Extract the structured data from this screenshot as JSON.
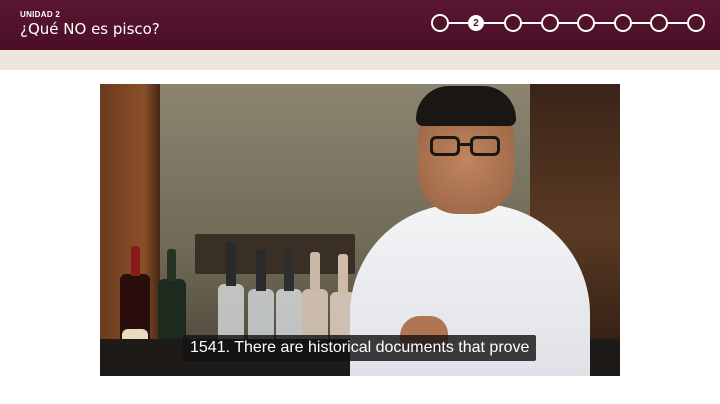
{
  "header": {
    "unit_label": "UNIDAD 2",
    "lesson_title": "¿Qué NO es pisco?"
  },
  "stepper": {
    "steps": [
      {
        "label": "",
        "active": false
      },
      {
        "label": "2",
        "active": true
      },
      {
        "label": "",
        "active": false
      },
      {
        "label": "",
        "active": false
      },
      {
        "label": "",
        "active": false
      },
      {
        "label": "",
        "active": false
      },
      {
        "label": "",
        "active": false
      },
      {
        "label": "",
        "active": false
      }
    ]
  },
  "video": {
    "caption": "1541. There are historical documents that prove"
  },
  "colors": {
    "header_bg": "#4f1229",
    "subbar_bg": "#ede6df",
    "stepper_line": "#ffffff"
  }
}
